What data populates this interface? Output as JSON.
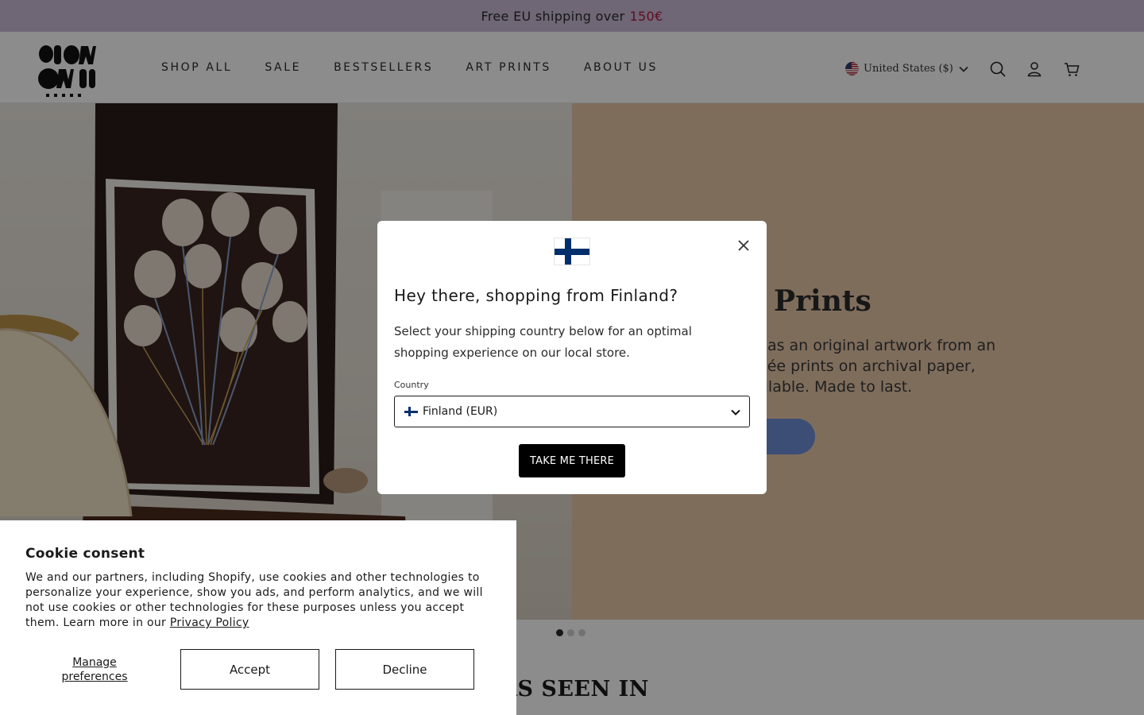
{
  "announcement": {
    "text": "Free EU shipping over",
    "amount": "150€",
    "accent_color": "#b0183a"
  },
  "header": {
    "logo_text": "SLOW DOWN studio",
    "nav": [
      "SHOP ALL",
      "SALE",
      "BESTSELLERS",
      "ART PRINTS",
      "ABOUT US"
    ],
    "country_selector": "United States ($)",
    "icons": [
      "search-icon",
      "account-icon",
      "cart-icon"
    ]
  },
  "hero": {
    "title_partial": "Prints",
    "text_partial": "s as an original artwork from an clée prints on archival paper, ailable. Made to last.",
    "button_color": "#6d8fd8",
    "slides": 3,
    "active_slide": 1
  },
  "section": {
    "title_partial": "AS SEEN IN"
  },
  "modal": {
    "flag": "finland-flag",
    "title": "Hey there, shopping from Finland?",
    "description": "Select your shipping country below for an optimal shopping experience on our local store.",
    "country_label": "Country",
    "country_value": "Finland (EUR)",
    "submit_label": "TAKE ME THERE"
  },
  "cookie": {
    "title": "Cookie consent",
    "text": "We and our partners, including Shopify, use cookies and other technologies to personalize your experience, show you ads, and perform analytics, and we will not use cookies or other technologies for these purposes unless you accept them. Learn more in our",
    "link": "Privacy Policy",
    "manage_label": "Manage preferences",
    "accept_label": "Accept",
    "decline_label": "Decline"
  }
}
